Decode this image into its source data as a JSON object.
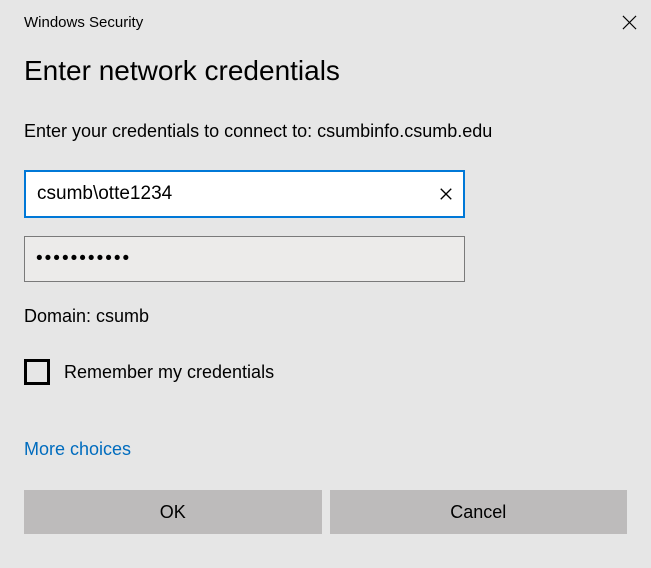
{
  "titlebar": {
    "title": "Windows Security"
  },
  "dialog": {
    "heading": "Enter network credentials",
    "subtext": "Enter your credentials to connect to: csumbinfo.csumb.edu",
    "username_value": "csumb\\otte1234",
    "password_value": "•••••••••••",
    "domain_text": "Domain: csumb",
    "remember_label": "Remember my credentials",
    "more_choices": "More choices",
    "ok_label": "OK",
    "cancel_label": "Cancel"
  }
}
